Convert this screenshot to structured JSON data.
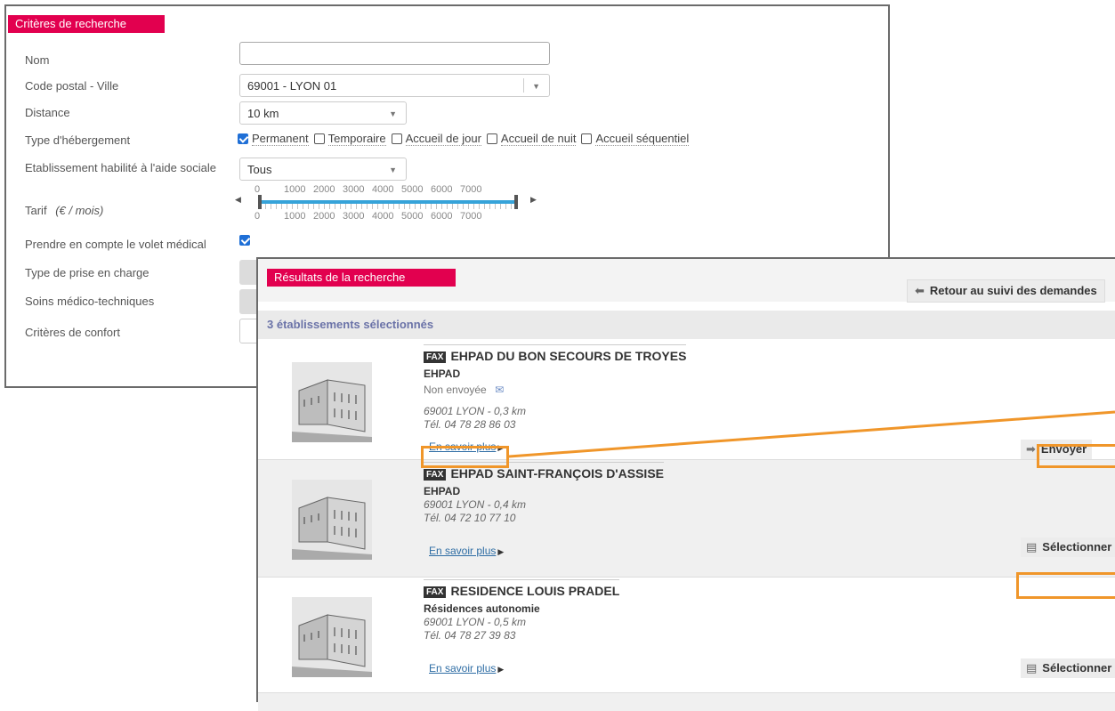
{
  "criteria": {
    "title": "Critères de recherche",
    "nom_label": "Nom",
    "nom_value": "",
    "code_postal_label": "Code postal - Ville",
    "code_postal_value": "69001 - LYON 01",
    "distance_label": "Distance",
    "distance_value": "10 km",
    "type_hebergement_label": "Type d'hébergement",
    "type_options": [
      {
        "label": "Permanent",
        "checked": true
      },
      {
        "label": "Temporaire",
        "checked": false
      },
      {
        "label": "Accueil de jour",
        "checked": false
      },
      {
        "label": "Accueil de nuit",
        "checked": false
      },
      {
        "label": "Accueil séquentiel",
        "checked": false
      }
    ],
    "aide_sociale_label": "Etablissement habilité à l'aide sociale",
    "aide_sociale_value": "Tous",
    "tarif_label": "Tarif",
    "tarif_unit": "(€ / mois)",
    "tarif_ticks": [
      "0",
      "1000",
      "2000",
      "3000",
      "4000",
      "5000",
      "6000",
      "7000"
    ],
    "tarif_min": 0,
    "tarif_max": 7000,
    "volet_medical_label": "Prendre en compte le volet médical",
    "volet_medical_checked": true,
    "prise_en_charge_label": "Type de prise en charge",
    "soins_label": "Soins médico-techniques",
    "confort_label": "Critères de confort"
  },
  "results": {
    "title": "Résultats de la recherche",
    "back_label": "Retour au suivi des demandes",
    "count_text": "3 établissements sélectionnés",
    "fax_badge": "FAX",
    "more_label": "En savoir plus",
    "items": [
      {
        "name": "EHPAD DU BON SECOURS DE TROYES",
        "type": "EHPAD",
        "status": "Non envoyée",
        "address": "69001 LYON - 0,3 km",
        "phone": "Tél. 04 78 28 86 03",
        "action": "Envoyer"
      },
      {
        "name": "EHPAD SAINT-FRANÇOIS D'ASSISE",
        "type": "EHPAD",
        "address": "69001 LYON - 0,4 km",
        "phone": "Tél. 04 72 10 77 10",
        "action": "Sélectionner"
      },
      {
        "name": "RESIDENCE LOUIS PRADEL",
        "type": "Résidences autonomie",
        "address": "69001 LYON - 0,5 km",
        "phone": "Tél. 04 78 27 39 83",
        "action": "Sélectionner"
      }
    ]
  },
  "colors": {
    "accent": "#e2004f",
    "highlight": "#f0962a",
    "slider": "#36a3d9"
  },
  "icons": {
    "back": "arrow-left-icon",
    "send": "arrow-right-icon",
    "select": "document-add-icon",
    "status": "envelope-pen-icon"
  }
}
